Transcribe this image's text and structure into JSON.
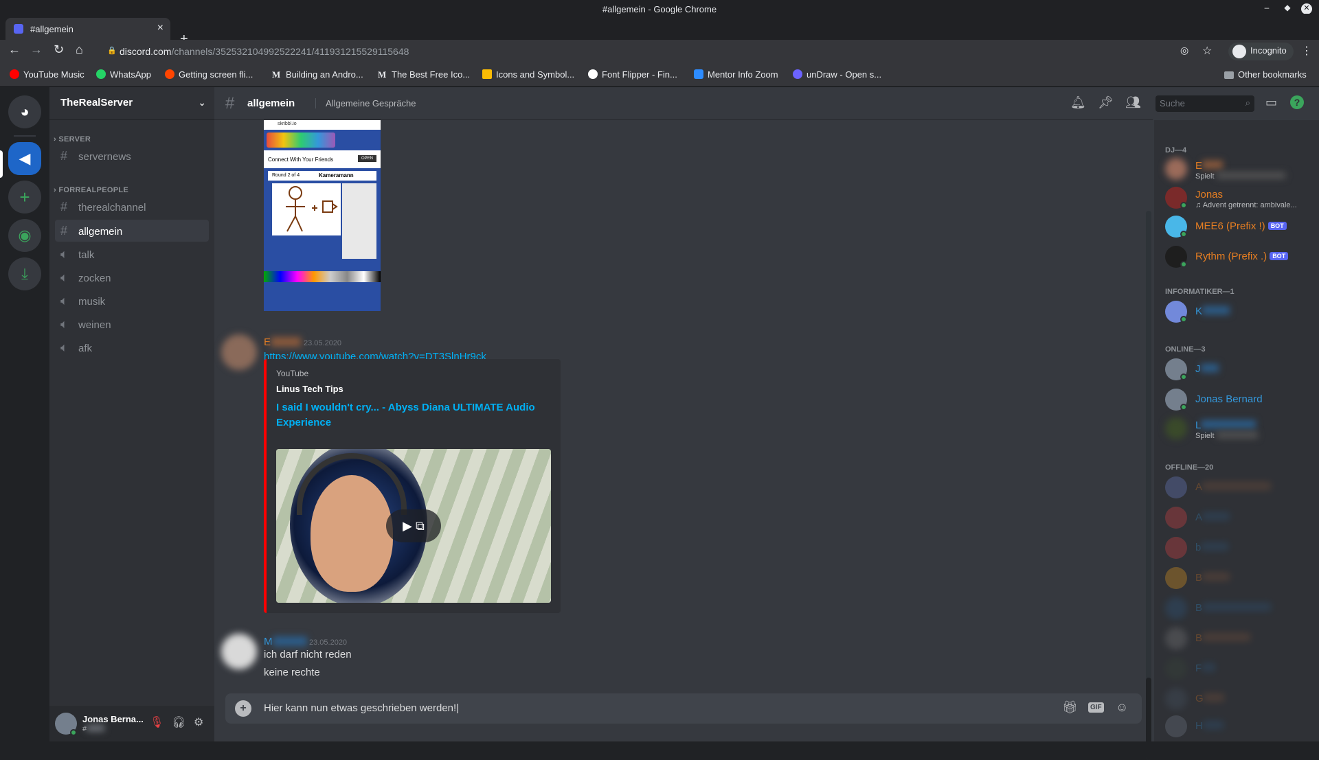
{
  "browser": {
    "window_title": "#allgemein - Google Chrome",
    "tab_title": "#allgemein",
    "url_host": "discord.com",
    "url_path": "/channels/352532104992522241/411931215529115648",
    "profile": "Incognito",
    "bookmarks": [
      {
        "label": "YouTube Music",
        "color": "#ff0000"
      },
      {
        "label": "WhatsApp",
        "color": "#25d366"
      },
      {
        "label": "Getting screen fli...",
        "color": "#ff4500"
      },
      {
        "label": "Building an Andro...",
        "color": ""
      },
      {
        "label": "The Best Free Ico...",
        "color": ""
      },
      {
        "label": "Icons and Symbol...",
        "color": "#fbbc04"
      },
      {
        "label": "Font Flipper - Fin...",
        "color": "#ffffff"
      },
      {
        "label": "Mentor Info Zoom",
        "color": "#2d8cff"
      },
      {
        "label": "unDraw - Open s...",
        "color": "#6c63ff"
      }
    ],
    "other_bookmarks": "Other bookmarks"
  },
  "server": {
    "name": "TheRealServer",
    "categories": [
      {
        "name": "SERVER",
        "channels": [
          {
            "name": "servernews",
            "type": "text"
          }
        ]
      },
      {
        "name": "FORREALPEOPLE",
        "channels": [
          {
            "name": "therealchannel",
            "type": "text"
          },
          {
            "name": "allgemein",
            "type": "text",
            "active": true
          },
          {
            "name": "talk",
            "type": "voice"
          },
          {
            "name": "zocken",
            "type": "voice"
          },
          {
            "name": "musik",
            "type": "voice"
          },
          {
            "name": "weinen",
            "type": "voice"
          },
          {
            "name": "afk",
            "type": "voice"
          }
        ]
      }
    ]
  },
  "user": {
    "name": "Jonas Berna...",
    "tag": "#"
  },
  "channel": {
    "name": "allgemein",
    "topic": "Allgemeine Gespräche",
    "search_placeholder": "Suche"
  },
  "messages": [
    {
      "author": "E",
      "time": "23.05.2020",
      "link": "https://www.youtube.com/watch?v=DT3SlnHr9ck",
      "embed": {
        "provider": "YouTube",
        "author": "Linus Tech Tips",
        "title": "I said I wouldn't cry... - Abyss Diana ULTIMATE Audio Experience"
      }
    },
    {
      "author": "M",
      "time": "23.05.2020",
      "lines": [
        "ich darf nicht reden",
        "keine rechte"
      ]
    }
  ],
  "screenshot_image": {
    "url": "skribbl.io",
    "headline": "Connect With Your Friends",
    "open_btn": "OPEN",
    "round": "Round 2 of 4",
    "word": "Kameramann"
  },
  "composer": {
    "text": "Hier kann nun etwas geschrieben werden!"
  },
  "members": {
    "groups": [
      {
        "title": "DJ—4",
        "members": [
          {
            "name": "E",
            "sub": "Spielt",
            "color": "#e67e22",
            "blur": true
          },
          {
            "name": "Jonas",
            "sub": "Advent getrennt: ambivale...",
            "color": "#e67e22"
          },
          {
            "name": "MEE6 (Prefix !)",
            "bot": "BOT",
            "color": "#e67e22"
          },
          {
            "name": "Rythm (Prefix .)",
            "bot": "BOT",
            "color": "#e67e22"
          }
        ]
      },
      {
        "title": "INFORMATIKER—1",
        "members": [
          {
            "name": "K",
            "color": "#3498db",
            "blur": true
          }
        ]
      },
      {
        "title": "ONLINE—3",
        "members": [
          {
            "name": "J",
            "color": "#3498db",
            "blur": true
          },
          {
            "name": "Jonas Bernard",
            "color": "#3498db"
          },
          {
            "name": "L",
            "sub": "Spielt",
            "color": "#3498db",
            "blur": true
          }
        ]
      },
      {
        "title": "OFFLINE—20",
        "members": [
          {
            "name": "A",
            "color": "#e67e22",
            "blur": true
          },
          {
            "name": "A",
            "color": "#3498db",
            "blur": true
          },
          {
            "name": "b",
            "color": "#3498db",
            "blur": true
          },
          {
            "name": "B",
            "color": "#e67e22",
            "blur": true
          },
          {
            "name": "B",
            "color": "#3498db",
            "blur": true
          },
          {
            "name": "B",
            "color": "#e67e22",
            "blur": true
          },
          {
            "name": "F",
            "color": "#3498db",
            "blur": true
          },
          {
            "name": "G",
            "color": "#e67e22",
            "blur": true
          },
          {
            "name": "H",
            "color": "#3498db",
            "blur": true
          }
        ]
      }
    ]
  },
  "icons": {
    "bell": "bell-icon",
    "pin": "pin-icon",
    "members": "members-icon",
    "inbox": "inbox-icon",
    "help": "help-icon",
    "gift": "gift-icon",
    "gif": "GIF",
    "emoji": "emoji-icon"
  }
}
